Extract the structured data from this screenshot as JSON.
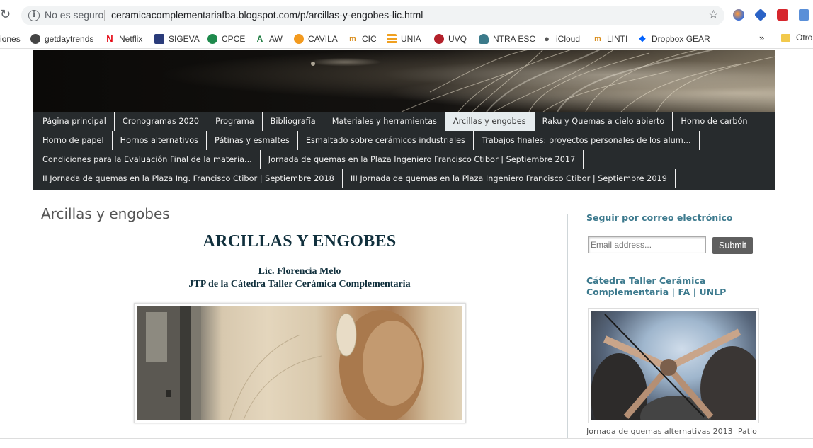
{
  "browser": {
    "security_label": "No es seguro",
    "url": "ceramicacomplementariafba.blogspot.com/p/arcillas-y-engobes-lic.html"
  },
  "bookmarks": {
    "items": [
      {
        "label": "iones",
        "icon": "none"
      },
      {
        "label": "getdaytrends",
        "icon": "getdaytrends-icon"
      },
      {
        "label": "Netflix",
        "icon": "netflix-icon"
      },
      {
        "label": "SIGEVA",
        "icon": "sigeva-icon"
      },
      {
        "label": "CPCE",
        "icon": "cpce-icon"
      },
      {
        "label": "AW",
        "icon": "aw-icon"
      },
      {
        "label": "CAVILA",
        "icon": "cavila-icon"
      },
      {
        "label": "CIC",
        "icon": "cic-icon"
      },
      {
        "label": "UNIA",
        "icon": "unia-icon"
      },
      {
        "label": "UVQ",
        "icon": "uvq-icon"
      },
      {
        "label": "NTRA ESC",
        "icon": "ntra-esc-icon"
      },
      {
        "label": "iCloud",
        "icon": "apple-icon"
      },
      {
        "label": "LINTI",
        "icon": "linti-icon"
      },
      {
        "label": "Dropbox GEAR",
        "icon": "dropbox-icon"
      }
    ],
    "more": "»",
    "other": "Otro"
  },
  "nav": {
    "rows": [
      [
        "Página principal",
        "Cronogramas 2020",
        "Programa",
        "Bibliografía",
        "Materiales y herramientas",
        "Arcillas y engobes",
        "Raku y Quemas a cielo abierto",
        "Horno de carbón"
      ],
      [
        "Horno de papel",
        "Hornos alternativos",
        "Pátinas y esmaltes",
        "Esmaltado sobre cerámicos industriales",
        "Trabajos finales: proyectos personales de los alum..."
      ],
      [
        "Condiciones para la Evaluación Final de la materia...",
        "Jornada de quemas en la Plaza Ingeniero Francisco Ctibor | Septiembre 2017"
      ],
      [
        "II Jornada de quemas en la Plaza Ing. Francisco Ctibor | Septiembre 2018",
        "III Jornada de quemas en la Plaza Ingeniero Francisco Ctibor | Septiembre 2019"
      ]
    ],
    "active": "Arcillas y engobes"
  },
  "main": {
    "page_title": "Arcillas y engobes",
    "post_heading": "ARCILLAS Y ENGOBES",
    "author": "Lic. Florencia Melo",
    "role": "JTP de la Cátedra Taller Cerámica Complementaria"
  },
  "sidebar": {
    "follow_title": "Seguir por correo electrónico",
    "email_placeholder": "Email address...",
    "submit_label": "Submit",
    "catedra_title": "Cátedra Taller Cerámica Complementaria | FA | UNLP",
    "caption": "Jornada de quemas alternativas 2013| Patio"
  },
  "colors": {
    "nav_bg": "#272b2d",
    "nav_active_bg": "#e6ecee",
    "sidebar_heading": "#3d7a8e",
    "post_heading": "#11303d"
  }
}
